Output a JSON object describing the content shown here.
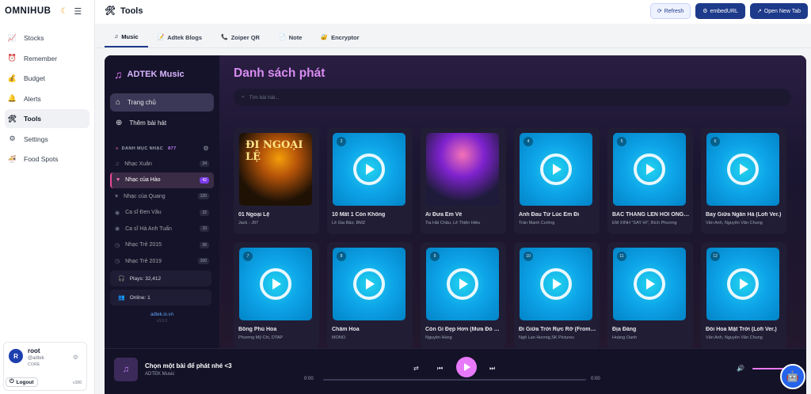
{
  "brand": {
    "name": "OMNIHUB"
  },
  "sidebar": {
    "items": [
      {
        "label": "Stocks",
        "icon": "chart-icon"
      },
      {
        "label": "Remember",
        "icon": "alarm-icon"
      },
      {
        "label": "Budget",
        "icon": "moneybag-icon"
      },
      {
        "label": "Alerts",
        "icon": "bell-icon"
      },
      {
        "label": "Tools",
        "icon": "tools-icon",
        "active": true
      },
      {
        "label": "Settings",
        "icon": "gear-icon"
      },
      {
        "label": "Food Spots",
        "icon": "bowl-icon"
      }
    ]
  },
  "user": {
    "initial": "R",
    "name": "root",
    "handle": "@adtek",
    "role": "CORE",
    "logout_label": "Logout",
    "version": "v100"
  },
  "header": {
    "title": "Tools",
    "buttons": {
      "refresh": "Refresh",
      "embed": "embedURL",
      "open_new": "Open New Tab"
    }
  },
  "tabs": [
    {
      "label": "Music",
      "active": true
    },
    {
      "label": "Adtek Blogs"
    },
    {
      "label": "Zoiper QR"
    },
    {
      "label": "Note"
    },
    {
      "label": "Encryptor"
    }
  ],
  "music": {
    "logo": "ADTEK Music",
    "nav": {
      "home": "Trang chủ",
      "add": "Thêm bài hát"
    },
    "section": {
      "title": "DANH MỤC NHẠC",
      "count": "877"
    },
    "playlists": [
      {
        "name": "Nhạc Xuân",
        "count": "34"
      },
      {
        "name": "Nhạc của Hào",
        "count": "42",
        "active": true
      },
      {
        "name": "Nhạc của Quang",
        "count": "120"
      },
      {
        "name": "Ca sĩ Đen Vâu",
        "count": "32"
      },
      {
        "name": "Ca sĩ Hà Anh Tuấn",
        "count": "10"
      },
      {
        "name": "Nhạc Trẻ 2015",
        "count": "36"
      },
      {
        "name": "Nhạc Trẻ 2019",
        "count": "100"
      }
    ],
    "stats": {
      "plays": "Plays: 32,412",
      "online": "Online: 1"
    },
    "site": "adtek.io.vn",
    "site_version": "v3.0.0",
    "main_title": "Danh sách phát",
    "search_placeholder": "Tìm bài hát...",
    "songs": [
      {
        "num": "1",
        "title": "01 Ngoại Lệ",
        "artist": "Jack - J97",
        "cover": "photo1",
        "cover_text": "ĐI NGOẠI LỆ"
      },
      {
        "num": "2",
        "title": "10 Mất 1 Còn Không",
        "artist": "Lê Gia Bảo, BMZ"
      },
      {
        "num": "3",
        "title": "Ai Đưa Em Về",
        "artist": "Tia Hải Châu, Lê Thiện Hiếu",
        "cover": "photo3"
      },
      {
        "num": "4",
        "title": "Anh Đau Từ Lúc Em Đi",
        "artist": "Trần Mạnh Cường"
      },
      {
        "num": "5",
        "title": "BẮC THANG LÊN HỎI ÔNG TRỜI",
        "artist": "EM XINH \"SAY HI\", Bích Phương"
      },
      {
        "num": "6",
        "title": "Bay Giữa Ngân Hà (Lofi Ver.)",
        "artist": "Văn Anh, Nguyễn Văn Chung"
      },
      {
        "num": "7",
        "title": "Bông Phù Hoa",
        "artist": "Phương Mỹ Chi, DTAP"
      },
      {
        "num": "8",
        "title": "Chăm Hoa",
        "artist": "MONO"
      },
      {
        "num": "9",
        "title": "Còn Gì Đẹp Hơn (Mưa Đỏ Original Soundtrack)",
        "artist": "Nguyễn Hùng"
      },
      {
        "num": "10",
        "title": "Đi Giữa Trời Rực Rỡ (From Đi Giữa Trời Rực Rỡ)",
        "artist": "Ngô Lan Hương,SK Pictures"
      },
      {
        "num": "11",
        "title": "Địa Đàng",
        "artist": "Hoàng Oanh"
      },
      {
        "num": "12",
        "title": "Đồi Hoa Mặt Trời (Lofi Ver.)",
        "artist": "Văn Anh, Nguyễn Văn Chung"
      }
    ],
    "player": {
      "title": "Chọn một bài để phát nhé <3",
      "artist": "ADTEK Music",
      "time_current": "0:00",
      "time_total": "0:00",
      "progress": 0.0
    }
  },
  "colors": {
    "accent": "#1e3a8a",
    "music_accent": "#e879f9",
    "tile": "#0ea5e9"
  }
}
